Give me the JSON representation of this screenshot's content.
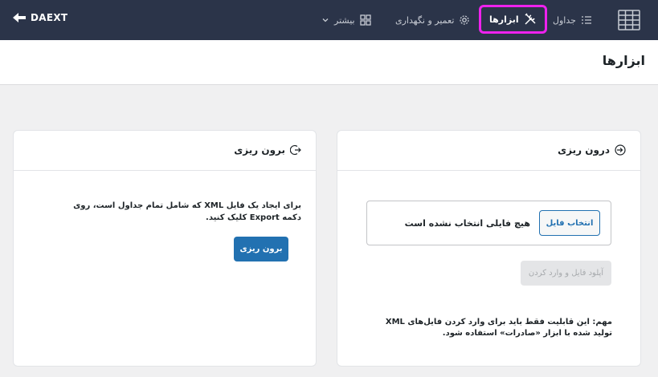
{
  "brand": {
    "name": "DAEXT"
  },
  "nav": {
    "tables": "جداول",
    "tools": "ابزارها",
    "maintenance": "تعمیر و نگهداری",
    "more": "بیشتر"
  },
  "page": {
    "title": "ابزارها"
  },
  "import_card": {
    "title": "درون ریزی",
    "choose_button": "انتخاب فایل",
    "no_file_text": "هیچ فایلی انتخاب نشده است",
    "upload_button": "آپلود فایل و وارد کردن",
    "note": "مهم: این قابلیت فقط باید برای وارد کردن فایل‌های XML تولید شده با ابزار «صادرات» استفاده شود."
  },
  "export_card": {
    "title": "برون ریزی",
    "description": "برای ایجاد یک فایل XML که شامل تمام جداول است، روی دکمه Export کلیک کنید.",
    "export_button": "برون ریزی"
  },
  "colors": {
    "topbar": "#2b3449",
    "accent": "#2271b1",
    "highlight": "#ee22ee"
  }
}
